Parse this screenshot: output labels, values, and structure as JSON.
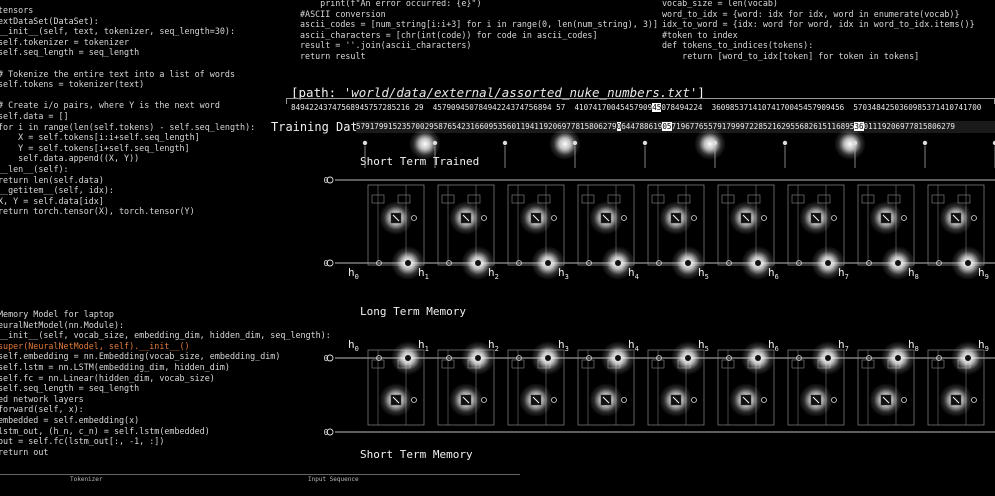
{
  "code_left_top": [
    "tensors",
    "extDataSet(DataSet):",
    "__init__(self, text, tokenizer, seq_length=30):",
    "self.tokenizer = tokenizer",
    "self.seq_length = seq_length",
    "",
    "# Tokenize the entire text into a list of words",
    "self.tokens = tokenizer(text)",
    "",
    "# Create i/o pairs, where Y is the next word",
    "self.data = []",
    "for i in range(len(self.tokens) - self.seq_length):",
    "    X = self.tokens[i:i+self.seq_length]",
    "    Y = self.tokens[i+self.seq_length]",
    "    self.data.append((X, Y))",
    "__len__(self):",
    "return len(self.data)",
    "__getitem__(self, idx):",
    "X, Y = self.data[idx]",
    "return torch.tensor(X), torch.tensor(Y)"
  ],
  "code_left_bottom": [
    "Memory Model for laptop",
    "euralNetModel(nn.Module):",
    "__init__(self, vocab_size, embedding_dim, hidden_dim, seq_length):",
    "super(NeuralNetModel, self).__init__()",
    "self.embedding = nn.Embedding(vocab_size, embedding_dim)",
    "self.lstm = nn.LSTM(embedding_dim, hidden_dim)",
    "self.fc = nn.Linear(hidden_dim, vocab_size)",
    "self.seq_length = seq_length",
    "ed network layers",
    "forward(self, x):",
    "embedded = self.embedding(x)",
    "lstm_out, (h_n, c_n) = self.lstm(embedded)",
    "out = self.fc(lstm_out[:, -1, :])",
    "return out"
  ],
  "code_mid": [
    "    print(f\"An error occurred: {e}\")",
    "#ASCII conversion",
    "ascii_codes = [num_string[i:i+3] for i in range(0, len(num_string), 3)]",
    "ascii_characters = [chr(int(code)) for code in ascii_codes]",
    "result = ''.join(ascii_characters)",
    "return result"
  ],
  "code_right": [
    "vocab_size = len(vocab)",
    "word_to_idx = {word: idx for idx, word in enumerate(vocab)}",
    "idx_to_word = {idx: word for word, idx in word_to_idx.items()}",
    "#token to index",
    "def tokens_to_indices(tokens):",
    "    return [word_to_idx[token] for token in tokens]"
  ],
  "path_prefix": "[path: ",
  "path_value": "'world/data/external/assorted_nuke_numbers.txt'",
  "path_suffix": "]",
  "number_strip": {
    "a": "84942243747568945757285216 29  45790945078494224374756894 57  41074170045457909",
    "hl": "45",
    "b": "078494224  36098537141074170045457909456  5703484250360985371410741700"
  },
  "training_label": "Training Data",
  "training_strip": {
    "a": "579179915235700295876542316609535601194119206977815806279",
    "hl1": "0",
    "b": "644788619",
    "hl2": "05",
    "c": "7196776557917999722852162955682615116895",
    "hl3": "36",
    "d": "01119206977815806279"
  },
  "titles": {
    "short_trained": "Short Term Trained",
    "long_memory": "Long Term Memory",
    "short_memory": "Short Term Memory"
  },
  "footer": {
    "tokenizer": "Tokenizer",
    "input_sequence": "Input Sequence"
  },
  "h_labels": [
    "h0",
    "h1",
    "h2",
    "h3",
    "h4",
    "h5",
    "h6",
    "h7",
    "h8",
    "h9"
  ],
  "zero_label": "0"
}
